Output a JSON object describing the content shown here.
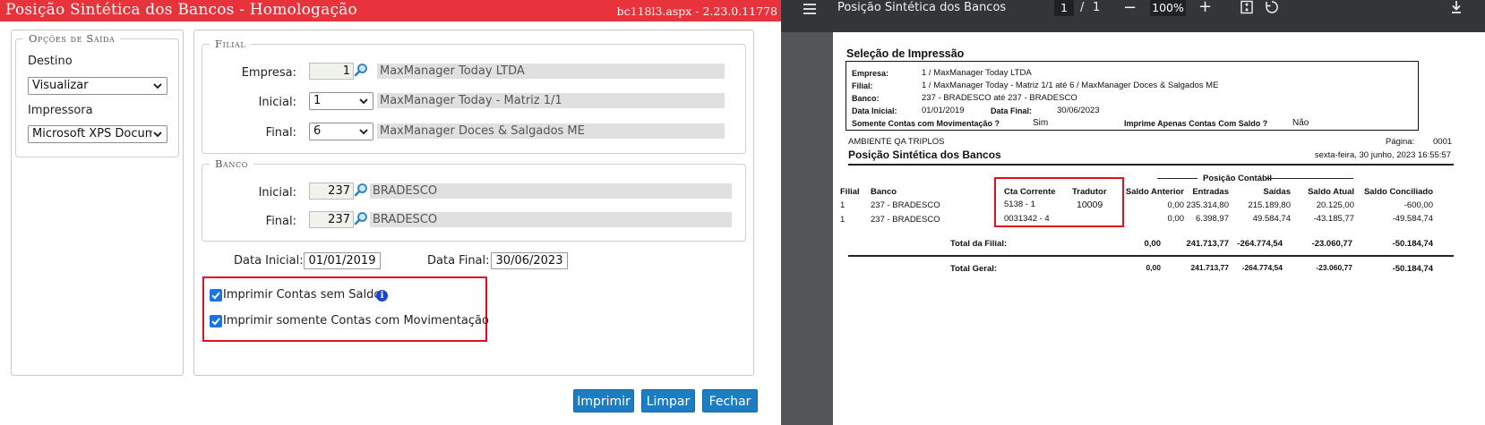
{
  "app": {
    "title": "Posição Sintética dos Bancos  - Homologação",
    "version": "bc118l3.aspx - 2.23.0.11778"
  },
  "output_options": {
    "legend": "Opções de Saída",
    "destination_label": "Destino",
    "destination_value": "Visualizar",
    "printer_label": "Impressora",
    "printer_value": "Microsoft XPS Docum"
  },
  "branch": {
    "legend": "Filial",
    "company_label": "Empresa:",
    "company_code": "1",
    "company_name": "MaxManager Today LTDA",
    "initial_label": "Inicial:",
    "initial_value": "1",
    "initial_name": "MaxManager Today - Matriz 1/1",
    "final_label": "Final:",
    "final_value": "6",
    "final_name": "MaxManager Doces & Salgados ME"
  },
  "bank": {
    "legend": "Banco",
    "initial_label": "Inicial:",
    "initial_code": "237",
    "initial_name": "BRADESCO",
    "final_label": "Final:",
    "final_code": "237",
    "final_name": "BRADESCO"
  },
  "dates": {
    "start_label": "Data Inicial:",
    "start_value": "01/01/2019",
    "end_label": "Data Final:",
    "end_value": "30/06/2023"
  },
  "checkboxes": {
    "no_balance_label": "Imprimir Contas sem Saldo",
    "with_movement_label": "Imprimir somente Contas com Movimentação"
  },
  "buttons": {
    "print": "Imprimir",
    "clear": "Limpar",
    "close": "Fechar"
  },
  "viewer": {
    "title": "Posição Sintética dos Bancos",
    "page_current": "1",
    "page_sep": "/",
    "page_total": "1",
    "zoom": "100%",
    "minus": "−",
    "plus": "+"
  },
  "report": {
    "selection_title": "Seleção de Impressão",
    "sel": {
      "company_label": "Empresa:",
      "company_value": "1 / MaxManager Today LTDA",
      "branch_label": "Filial:",
      "branch_value": "1 / MaxManager Today - Matriz 1/1 até 6 / MaxManager Doces & Salgados ME",
      "bank_label": "Banco:",
      "bank_value": "237 - BRADESCO até 237 - BRADESCO",
      "start_label": "Data Inicial:",
      "start_value": "01/01/2019",
      "end_label": "Data Final:",
      "end_value": "30/06/2023",
      "movement_label": "Somente Contas com Movimentação ?",
      "movement_value": "Sim",
      "balance_label": "Imprime Apenas Contas Com Saldo ?",
      "balance_value": "Não"
    },
    "environment": "AMBIENTE QA TRIPLOS",
    "page_label": "Página:",
    "page_value": "0001",
    "report_title": "Posição Sintética dos Bancos",
    "date_time": "sexta-feira, 30 junho, 2023  16:55:57",
    "group_header": "Posição Contábil",
    "columns": {
      "filial": "Filial",
      "banco": "Banco",
      "cta": "Cta Corrente",
      "tradutor": "Tradutor",
      "saldo_anterior": "Saldo Anterior",
      "entradas": "Entradas",
      "saidas": "Saídas",
      "saldo_atual": "Saldo Atual",
      "saldo_conciliado": "Saldo Conciliado"
    },
    "rows": [
      {
        "filial": "1",
        "banco": "237 - BRADESCO",
        "cta": "5138 - 1",
        "tradutor": "10009",
        "saldo_anterior": "0,00",
        "entradas": "235.314,80",
        "saidas": "215.189,80",
        "saldo_atual": "20.125,00",
        "saldo_conciliado": "-600,00"
      },
      {
        "filial": "1",
        "banco": "237 - BRADESCO",
        "cta": "0031342 - 4",
        "tradutor": "",
        "saldo_anterior": "0,00",
        "entradas": "6.398,97",
        "saidas": "49.584,74",
        "saldo_atual": "-43.185,77",
        "saldo_conciliado": "-49.584,74"
      }
    ],
    "total_filial": {
      "label": "Total da Filial:",
      "saldo_anterior": "0,00",
      "entradas": "241.713,77",
      "saidas": "-264.774,54",
      "saldo_atual": "-23.060,77",
      "saldo_conciliado": "-50.184,74"
    },
    "total_geral": {
      "label": "Total Geral:",
      "saldo_anterior": "0,00",
      "entradas": "241.713,77",
      "saidas": "-264.774,54",
      "saldo_atual": "-23.060,77",
      "saldo_conciliado": "-50.184,74"
    }
  },
  "colors": {
    "title_bar": "#e8323c",
    "button": "#1d7dc3",
    "highlight_box": "#e10f1f",
    "checkbox": "#1a73e8",
    "viewer_toolbar": "#323639",
    "viewer_background": "#525659"
  }
}
